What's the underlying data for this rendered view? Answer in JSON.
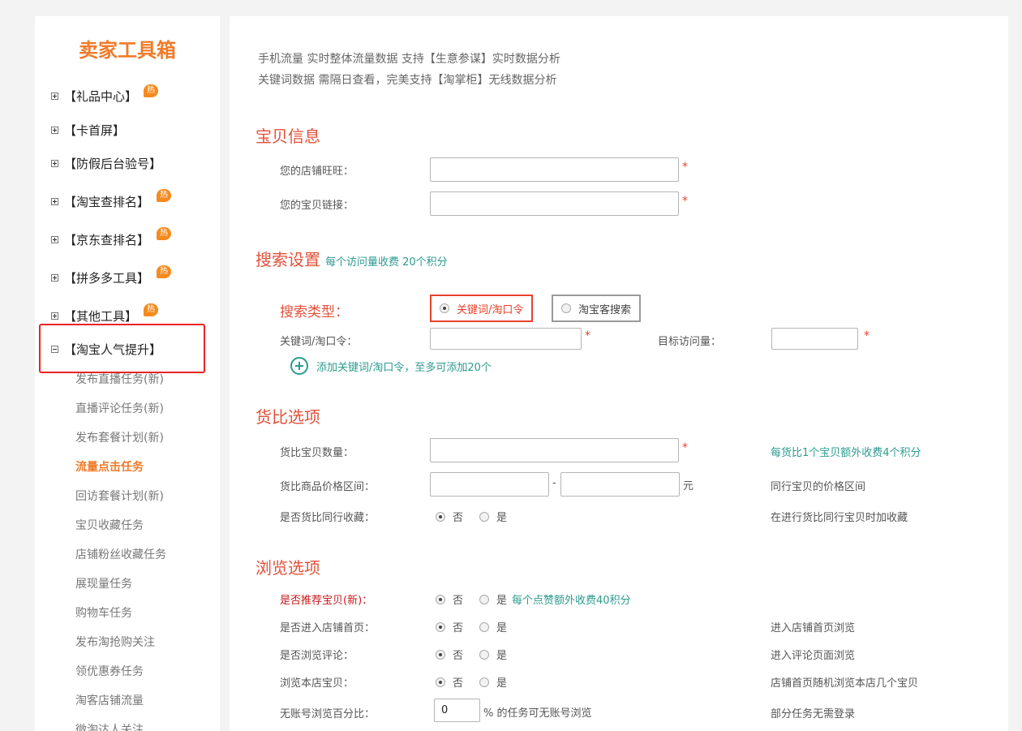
{
  "sidebar": {
    "title": "卖家工具箱",
    "menu": [
      {
        "label": "【礼品中心】",
        "hot": true,
        "expanded": false
      },
      {
        "label": "【卡首屏】",
        "hot": false,
        "expanded": false
      },
      {
        "label": "【防假后台验号】",
        "hot": false,
        "expanded": false
      },
      {
        "label": "【淘宝查排名】",
        "hot": true,
        "expanded": false
      },
      {
        "label": "【京东查排名】",
        "hot": true,
        "expanded": false
      },
      {
        "label": "【拼多多工具】",
        "hot": true,
        "expanded": false
      },
      {
        "label": "【其他工具】",
        "hot": true,
        "expanded": false
      },
      {
        "label": "【淘宝人气提升】",
        "hot": false,
        "expanded": true
      }
    ],
    "hot_label": "热",
    "sub_items": [
      "发布直播任务(新)",
      "直播评论任务(新)",
      "发布套餐计划(新)",
      "流量点击任务",
      "回访套餐计划(新)",
      "宝贝收藏任务",
      "店铺粉丝收藏任务",
      "展现量任务",
      "购物车任务",
      "发布淘抢购关注",
      "领优惠券任务",
      "淘客店铺流量",
      "微淘达人关注"
    ],
    "active_sub_item": "流量点击任务"
  },
  "main": {
    "desc_line1": "手机流量 实时整体流量数据 支持【生意参谋】实时数据分析",
    "desc_line2": "关键词数据 需隔日查看，完美支持【淘掌柜】无线数据分析",
    "item_info": {
      "title": "宝贝信息",
      "shop_wangwang_label": "您的店铺旺旺：",
      "item_link_label": "您的宝贝链接：",
      "required_mark": "*"
    },
    "search_settings": {
      "title": "搜索设置",
      "note": "每个访问量收费 20个积分",
      "type_label": "搜索类型：",
      "type_keyword": "关键词/淘口令",
      "type_taoke": "淘宝客搜索",
      "keyword_label": "关键词/淘口令：",
      "target_visits_label": "目标访问量：",
      "add_keyword": "添加关键词/淘口令，至多可添加20个"
    },
    "compare_options": {
      "title": "货比选项",
      "count_label": "货比宝贝数量：",
      "count_hint": "每货比1个宝贝额外收费4个积分",
      "price_label": "货比商品价格区间：",
      "price_dash": "-",
      "price_unit": "元",
      "price_hint": "同行宝贝的价格区间",
      "fav_label": "是否货比同行收藏：",
      "fav_hint": "在进行货比同行宝贝时加收藏"
    },
    "browse_options": {
      "title": "浏览选项",
      "recommend_label": "是否推荐宝贝(新)：",
      "recommend_note": "每个点赞额外收费40积分",
      "home_label": "是否进入店铺首页：",
      "home_hint": "进入店铺首页浏览",
      "review_label": "是否浏览评论：",
      "review_hint": "进入评论页面浏览",
      "store_items_label": "浏览本店宝贝：",
      "store_items_hint": "店铺首页随机浏览本店几个宝贝",
      "no_account_label": "无账号浏览百分比：",
      "no_account_value": "0",
      "no_account_suffix": "% 的任务可无账号浏览",
      "no_account_hint": "部分任务无需登录"
    },
    "radio_no": "否",
    "radio_yes": "是"
  },
  "colors": {
    "accent_orange": "#f07b2a",
    "section_red": "#e2513a",
    "teal": "#2b9a8f",
    "highlight_red": "#e82323"
  }
}
